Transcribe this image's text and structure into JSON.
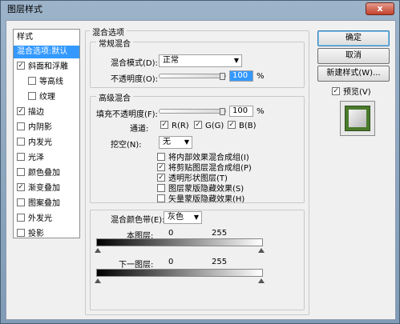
{
  "window": {
    "title": "图层样式",
    "close": "x"
  },
  "styles_panel": {
    "header": "样式",
    "items": [
      {
        "label": "混合选项:默认",
        "checkbox": false,
        "checked": false,
        "selected": true,
        "indent": false
      },
      {
        "label": "斜面和浮雕",
        "checkbox": true,
        "checked": true,
        "selected": false,
        "indent": false
      },
      {
        "label": "等高线",
        "checkbox": true,
        "checked": false,
        "selected": false,
        "indent": true
      },
      {
        "label": "纹理",
        "checkbox": true,
        "checked": false,
        "selected": false,
        "indent": true
      },
      {
        "label": "描边",
        "checkbox": true,
        "checked": true,
        "selected": false,
        "indent": false
      },
      {
        "label": "内阴影",
        "checkbox": true,
        "checked": false,
        "selected": false,
        "indent": false
      },
      {
        "label": "内发光",
        "checkbox": true,
        "checked": false,
        "selected": false,
        "indent": false
      },
      {
        "label": "光泽",
        "checkbox": true,
        "checked": false,
        "selected": false,
        "indent": false
      },
      {
        "label": "颜色叠加",
        "checkbox": true,
        "checked": false,
        "selected": false,
        "indent": false
      },
      {
        "label": "渐变叠加",
        "checkbox": true,
        "checked": true,
        "selected": false,
        "indent": false
      },
      {
        "label": "图案叠加",
        "checkbox": true,
        "checked": false,
        "selected": false,
        "indent": false
      },
      {
        "label": "外发光",
        "checkbox": true,
        "checked": false,
        "selected": false,
        "indent": false
      },
      {
        "label": "投影",
        "checkbox": true,
        "checked": false,
        "selected": false,
        "indent": false
      }
    ]
  },
  "blend_options": {
    "title": "混合选项",
    "general": {
      "title": "常规混合",
      "mode_label": "混合模式(D):",
      "mode_value": "正常",
      "opacity_label": "不透明度(O):",
      "opacity_value": "100",
      "opacity_unit": "%",
      "opacity_level": 1.0
    },
    "advanced": {
      "title": "高级混合",
      "fill_label": "填充不透明度(F):",
      "fill_value": "100",
      "fill_unit": "%",
      "fill_level": 1.0,
      "channels_label": "通道:",
      "channels": [
        {
          "label": "R(R)",
          "checked": true
        },
        {
          "label": "G(G)",
          "checked": true
        },
        {
          "label": "B(B)",
          "checked": true
        }
      ],
      "knockout_label": "挖空(N):",
      "knockout_value": "无",
      "options": [
        {
          "label": "将内部效果混合成组(I)",
          "checked": false
        },
        {
          "label": "将剪贴图层混合成组(P)",
          "checked": true
        },
        {
          "label": "透明形状图层(T)",
          "checked": true
        },
        {
          "label": "图层蒙版隐藏效果(S)",
          "checked": false
        },
        {
          "label": "矢量蒙版隐藏效果(H)",
          "checked": false
        }
      ]
    },
    "blend_if": {
      "label": "混合颜色带(E):",
      "value": "灰色",
      "this_layer_label": "本图层:",
      "this_layer_min": "0",
      "this_layer_max": "255",
      "under_layer_label": "下一图层:",
      "under_layer_min": "0",
      "under_layer_max": "255"
    }
  },
  "buttons": {
    "ok": "确定",
    "cancel": "取消",
    "new_style": "新建样式(W)...",
    "preview_label": "预览(V)",
    "preview_checked": true
  },
  "check_glyph": "✓",
  "colors": {
    "selection": "#3399ff",
    "preview_green": "#4a7a2c"
  }
}
